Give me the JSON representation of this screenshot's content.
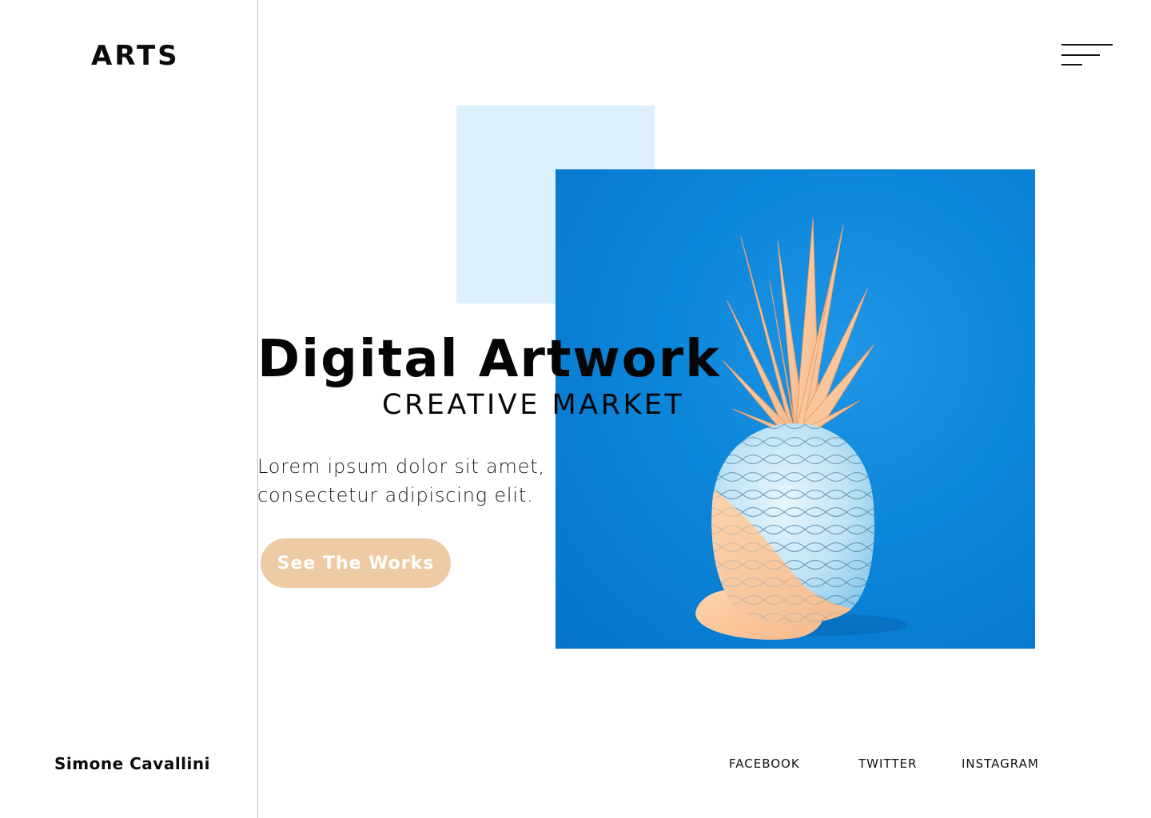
{
  "brand": {
    "logo": "ARTS",
    "author": "Simone Cavallini"
  },
  "header": {
    "menu_icon": "hamburger-menu-icon"
  },
  "hero": {
    "title": "Digital Artwork",
    "subtitle": "CREATIVE MARKET",
    "description": "Lorem ipsum dolor sit amet, consectetur adipiscing elit.",
    "cta_label": "See The Works",
    "image": "pineapple-artwork"
  },
  "social": {
    "facebook": "FACEBOOK",
    "twitter": "TWITTER",
    "instagram": "INSTAGRAM"
  },
  "colors": {
    "accent_peach": "#efcba5",
    "accent_light_blue": "#dbf0fc",
    "artwork_blue": "#0b84d8",
    "text": "#0b0b0b"
  }
}
